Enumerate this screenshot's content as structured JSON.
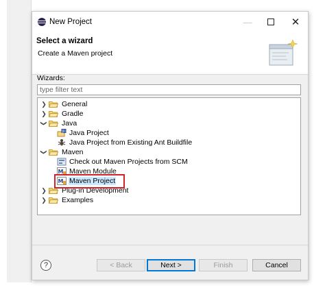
{
  "window": {
    "title": "New Project",
    "icon": "eclipse-icon",
    "controls": [
      "minimize-icon",
      "maximize-icon",
      "close-icon"
    ]
  },
  "header": {
    "title": "Select a wizard",
    "description": "Create a Maven project",
    "banner_icon": "wizard-banner-icon"
  },
  "wizards_label": "Wizards:",
  "filter": {
    "placeholder": "type filter text",
    "value": ""
  },
  "tree": {
    "items": [
      {
        "label": "General",
        "level": 0,
        "expanded": false,
        "icon": "folder-icon"
      },
      {
        "label": "Gradle",
        "level": 0,
        "expanded": false,
        "icon": "folder-icon"
      },
      {
        "label": "Java",
        "level": 0,
        "expanded": true,
        "icon": "folder-icon"
      },
      {
        "label": "Java Project",
        "level": 1,
        "icon": "java-project-icon"
      },
      {
        "label": "Java Project from Existing Ant Buildfile",
        "level": 1,
        "icon": "ant-icon"
      },
      {
        "label": "Maven",
        "level": 0,
        "expanded": true,
        "icon": "folder-icon"
      },
      {
        "label": "Check out Maven Projects from SCM",
        "level": 1,
        "icon": "scm-checkout-icon"
      },
      {
        "label": "Maven Module",
        "level": 1,
        "icon": "maven-module-icon"
      },
      {
        "label": "Maven Project",
        "level": 1,
        "icon": "maven-project-icon",
        "selected": true
      },
      {
        "label": "Plug-in Development",
        "level": 0,
        "expanded": false,
        "icon": "folder-icon"
      },
      {
        "label": "Examples",
        "level": 0,
        "expanded": false,
        "icon": "folder-icon"
      }
    ]
  },
  "buttons": {
    "help": "?",
    "back": "< Back",
    "next": "Next >",
    "finish": "Finish",
    "cancel": "Cancel"
  },
  "colors": {
    "selection": "#cce8ff",
    "highlight_box": "#d0212a",
    "default_button_border": "#0078d7",
    "folder": "#e8c069"
  }
}
